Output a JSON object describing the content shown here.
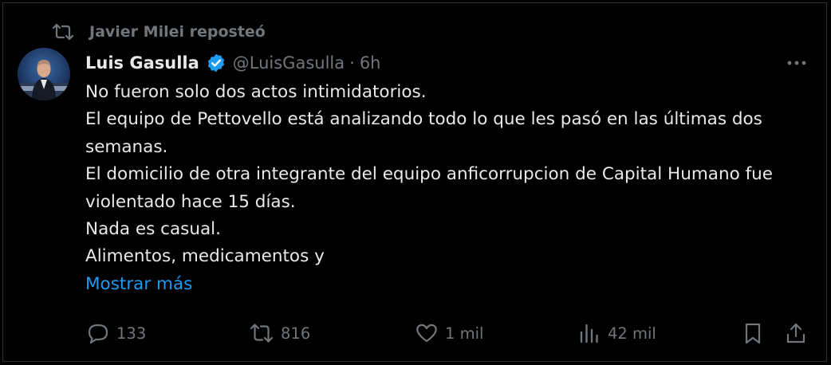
{
  "repost": {
    "text": "Javier Milei reposteó"
  },
  "author": {
    "name": "Luis Gasulla",
    "handle": "@LuisGasulla",
    "separator": "·",
    "time": "6h"
  },
  "tweet": {
    "lines": [
      "No fueron solo dos actos intimidatorios.",
      "El equipo de Pettovello está analizando todo lo que les pasó en las últimas dos semanas.",
      "El domicilio de otra integrante del equipo anficorrupcion de Capital Humano fue violentado hace 15 días.",
      "Nada es casual.",
      "Alimentos, medicamentos y"
    ],
    "show_more": "Mostrar más"
  },
  "actions": {
    "reply_count": "133",
    "repost_count": "816",
    "like_count": "1 mil",
    "views_count": "42 mil"
  },
  "colors": {
    "background": "#000000",
    "text": "#e7e9ea",
    "muted": "#71767b",
    "accent": "#1d9bf0",
    "border": "#2f3336"
  },
  "icons": {
    "repost": "repost-icon",
    "verified": "verified-badge-icon",
    "more": "more-icon",
    "reply": "reply-icon",
    "like": "heart-icon",
    "views": "views-icon",
    "bookmark": "bookmark-icon",
    "share": "share-icon"
  }
}
